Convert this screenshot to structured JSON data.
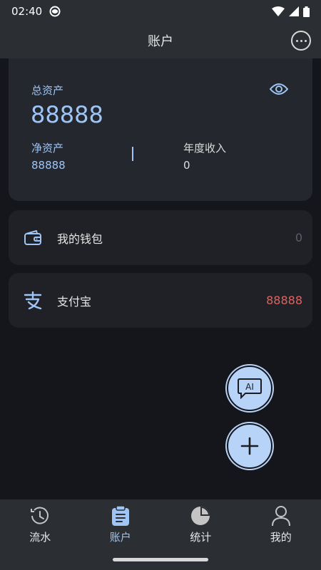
{
  "status_bar": {
    "time": "02:40",
    "icons": [
      "app-notification-icon",
      "wifi-icon",
      "signal-icon",
      "battery-icon"
    ]
  },
  "header": {
    "title": "账户",
    "more_icon": "more-horizontal-icon"
  },
  "summary": {
    "total_label": "总资产",
    "total_value": "88888",
    "net_label": "净资产",
    "net_value": "88888",
    "income_label": "年度收入",
    "income_value": "0",
    "visibility_icon": "eye-icon"
  },
  "accounts": [
    {
      "name": "我的钱包",
      "amount": "0",
      "icon": "wallet-icon",
      "amount_color": "#5c5f66"
    },
    {
      "name": "支付宝",
      "amount": "88888",
      "icon": "alipay-icon",
      "amount_color": "#e0625c"
    }
  ],
  "fabs": {
    "ai_label": "AI",
    "ai_icon": "ai-chat-icon",
    "add_icon": "plus-icon"
  },
  "bottom_nav": {
    "items": [
      {
        "label": "流水",
        "icon": "clock-icon",
        "active": false
      },
      {
        "label": "账户",
        "icon": "clipboard-icon",
        "active": true
      },
      {
        "label": "统计",
        "icon": "pie-chart-icon",
        "active": false
      },
      {
        "label": "我的",
        "icon": "user-icon",
        "active": false
      }
    ]
  },
  "colors": {
    "accent": "#9ec5f5",
    "background": "#14161b",
    "card": "#24272d",
    "negative": "#e0625c"
  }
}
